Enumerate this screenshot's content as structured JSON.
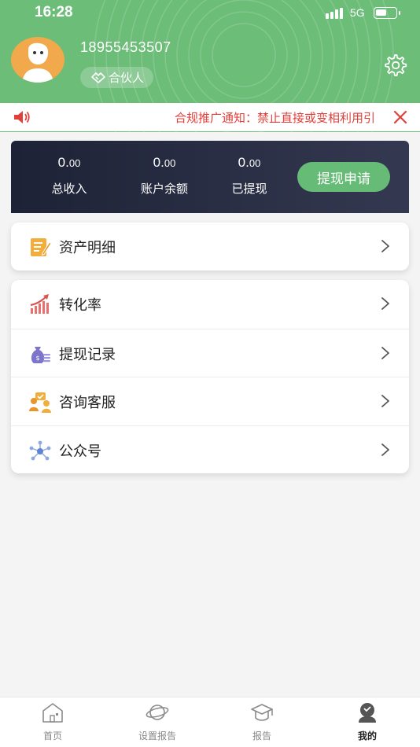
{
  "status_bar": {
    "time": "16:28",
    "network": "5G",
    "battery_level": 0.55
  },
  "profile": {
    "phone": "18955453507",
    "badge_label": "合伙人"
  },
  "notice": {
    "text": "合规推广通知：禁止直接或变相利用引"
  },
  "summary": {
    "stats": [
      {
        "value_int": "0.",
        "value_dec": "00",
        "label": "总收入"
      },
      {
        "value_int": "0.",
        "value_dec": "00",
        "label": "账户余额"
      },
      {
        "value_int": "0.",
        "value_dec": "00",
        "label": "已提现"
      }
    ],
    "withdraw_label": "提现申请"
  },
  "menu_primary": [
    {
      "label": "资产明细",
      "icon": "document-edit-icon"
    }
  ],
  "menu_secondary": [
    {
      "label": "转化率",
      "icon": "growth-chart-icon"
    },
    {
      "label": "提现记录",
      "icon": "money-bag-icon"
    },
    {
      "label": "咨询客服",
      "icon": "customer-service-icon"
    },
    {
      "label": "公众号",
      "icon": "network-nodes-icon"
    }
  ],
  "tabs": [
    {
      "label": "首页",
      "icon": "home-icon",
      "active": false
    },
    {
      "label": "设置报告",
      "icon": "planet-icon",
      "active": false
    },
    {
      "label": "报告",
      "icon": "graduation-cap-icon",
      "active": false
    },
    {
      "label": "我的",
      "icon": "user-icon",
      "active": true
    }
  ],
  "colors": {
    "header_green": "#6cbd78",
    "notice_red": "#e0403a",
    "card_dark": "#1d2236",
    "accent_green": "#66bc77"
  }
}
